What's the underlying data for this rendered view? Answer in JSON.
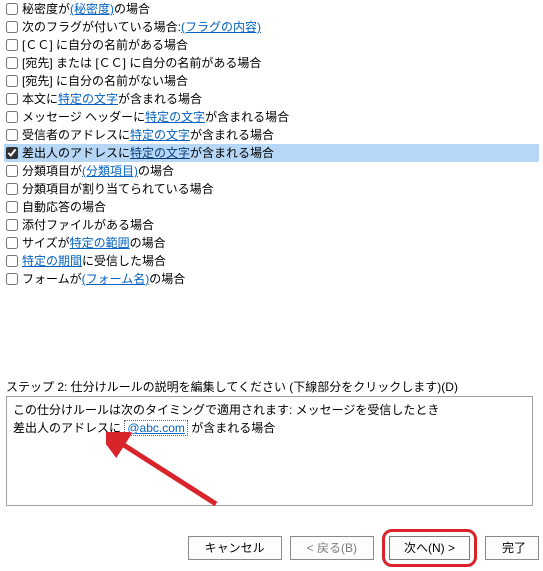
{
  "conditions": [
    {
      "checked": false,
      "parts": [
        {
          "t": "秘密度が "
        },
        {
          "t": "(秘密度)",
          "link": true
        },
        {
          "t": " の場合"
        }
      ]
    },
    {
      "checked": false,
      "parts": [
        {
          "t": "次のフラグが付いている場合: "
        },
        {
          "t": "(フラグの内容)",
          "link": true
        }
      ]
    },
    {
      "checked": false,
      "parts": [
        {
          "t": "[ＣＣ] に自分の名前がある場合"
        }
      ]
    },
    {
      "checked": false,
      "parts": [
        {
          "t": "[宛先] または [ＣＣ] に自分の名前がある場合"
        }
      ]
    },
    {
      "checked": false,
      "parts": [
        {
          "t": "[宛先] に自分の名前がない場合"
        }
      ]
    },
    {
      "checked": false,
      "parts": [
        {
          "t": "本文に "
        },
        {
          "t": "特定の文字",
          "link": true
        },
        {
          "t": " が含まれる場合"
        }
      ]
    },
    {
      "checked": false,
      "parts": [
        {
          "t": "メッセージ ヘッダーに "
        },
        {
          "t": "特定の文字",
          "link": true
        },
        {
          "t": " が含まれる場合"
        }
      ]
    },
    {
      "checked": false,
      "parts": [
        {
          "t": "受信者のアドレスに "
        },
        {
          "t": "特定の文字",
          "link": true
        },
        {
          "t": " が含まれる場合"
        }
      ]
    },
    {
      "checked": true,
      "selected": true,
      "parts": [
        {
          "t": "差出人のアドレスに "
        },
        {
          "t": "特定の文字",
          "link": true
        },
        {
          "t": " が含まれる場合"
        }
      ]
    },
    {
      "checked": false,
      "parts": [
        {
          "t": "分類項目が "
        },
        {
          "t": "(分類項目)",
          "link": true
        },
        {
          "t": " の場合"
        }
      ]
    },
    {
      "checked": false,
      "parts": [
        {
          "t": "分類項目が割り当てられている場合"
        }
      ]
    },
    {
      "checked": false,
      "parts": [
        {
          "t": "自動応答の場合"
        }
      ]
    },
    {
      "checked": false,
      "parts": [
        {
          "t": "添付ファイルがある場合"
        }
      ]
    },
    {
      "checked": false,
      "parts": [
        {
          "t": "サイズが "
        },
        {
          "t": "特定の範囲",
          "link": true
        },
        {
          "t": " の場合"
        }
      ]
    },
    {
      "checked": false,
      "parts": [
        {
          "t": " "
        },
        {
          "t": "特定の期間",
          "link": true
        },
        {
          "t": " に受信した場合"
        }
      ]
    },
    {
      "checked": false,
      "parts": [
        {
          "t": "フォームが "
        },
        {
          "t": "(フォーム名)",
          "link": true
        },
        {
          "t": " の場合"
        }
      ]
    }
  ],
  "step2": {
    "label": "ステップ 2: 仕分けルールの説明を編集してください (下線部分をクリックします)(D)",
    "line1": "この仕分けルールは次のタイミングで適用されます: メッセージを受信したとき",
    "line2_pre": "差出人のアドレスに ",
    "line2_link": "@abc.com",
    "line2_post": " が含まれる場合"
  },
  "buttons": {
    "cancel": "キャンセル",
    "back": "< 戻る(B)",
    "next": "次へ(N) >",
    "finish": "完了"
  }
}
